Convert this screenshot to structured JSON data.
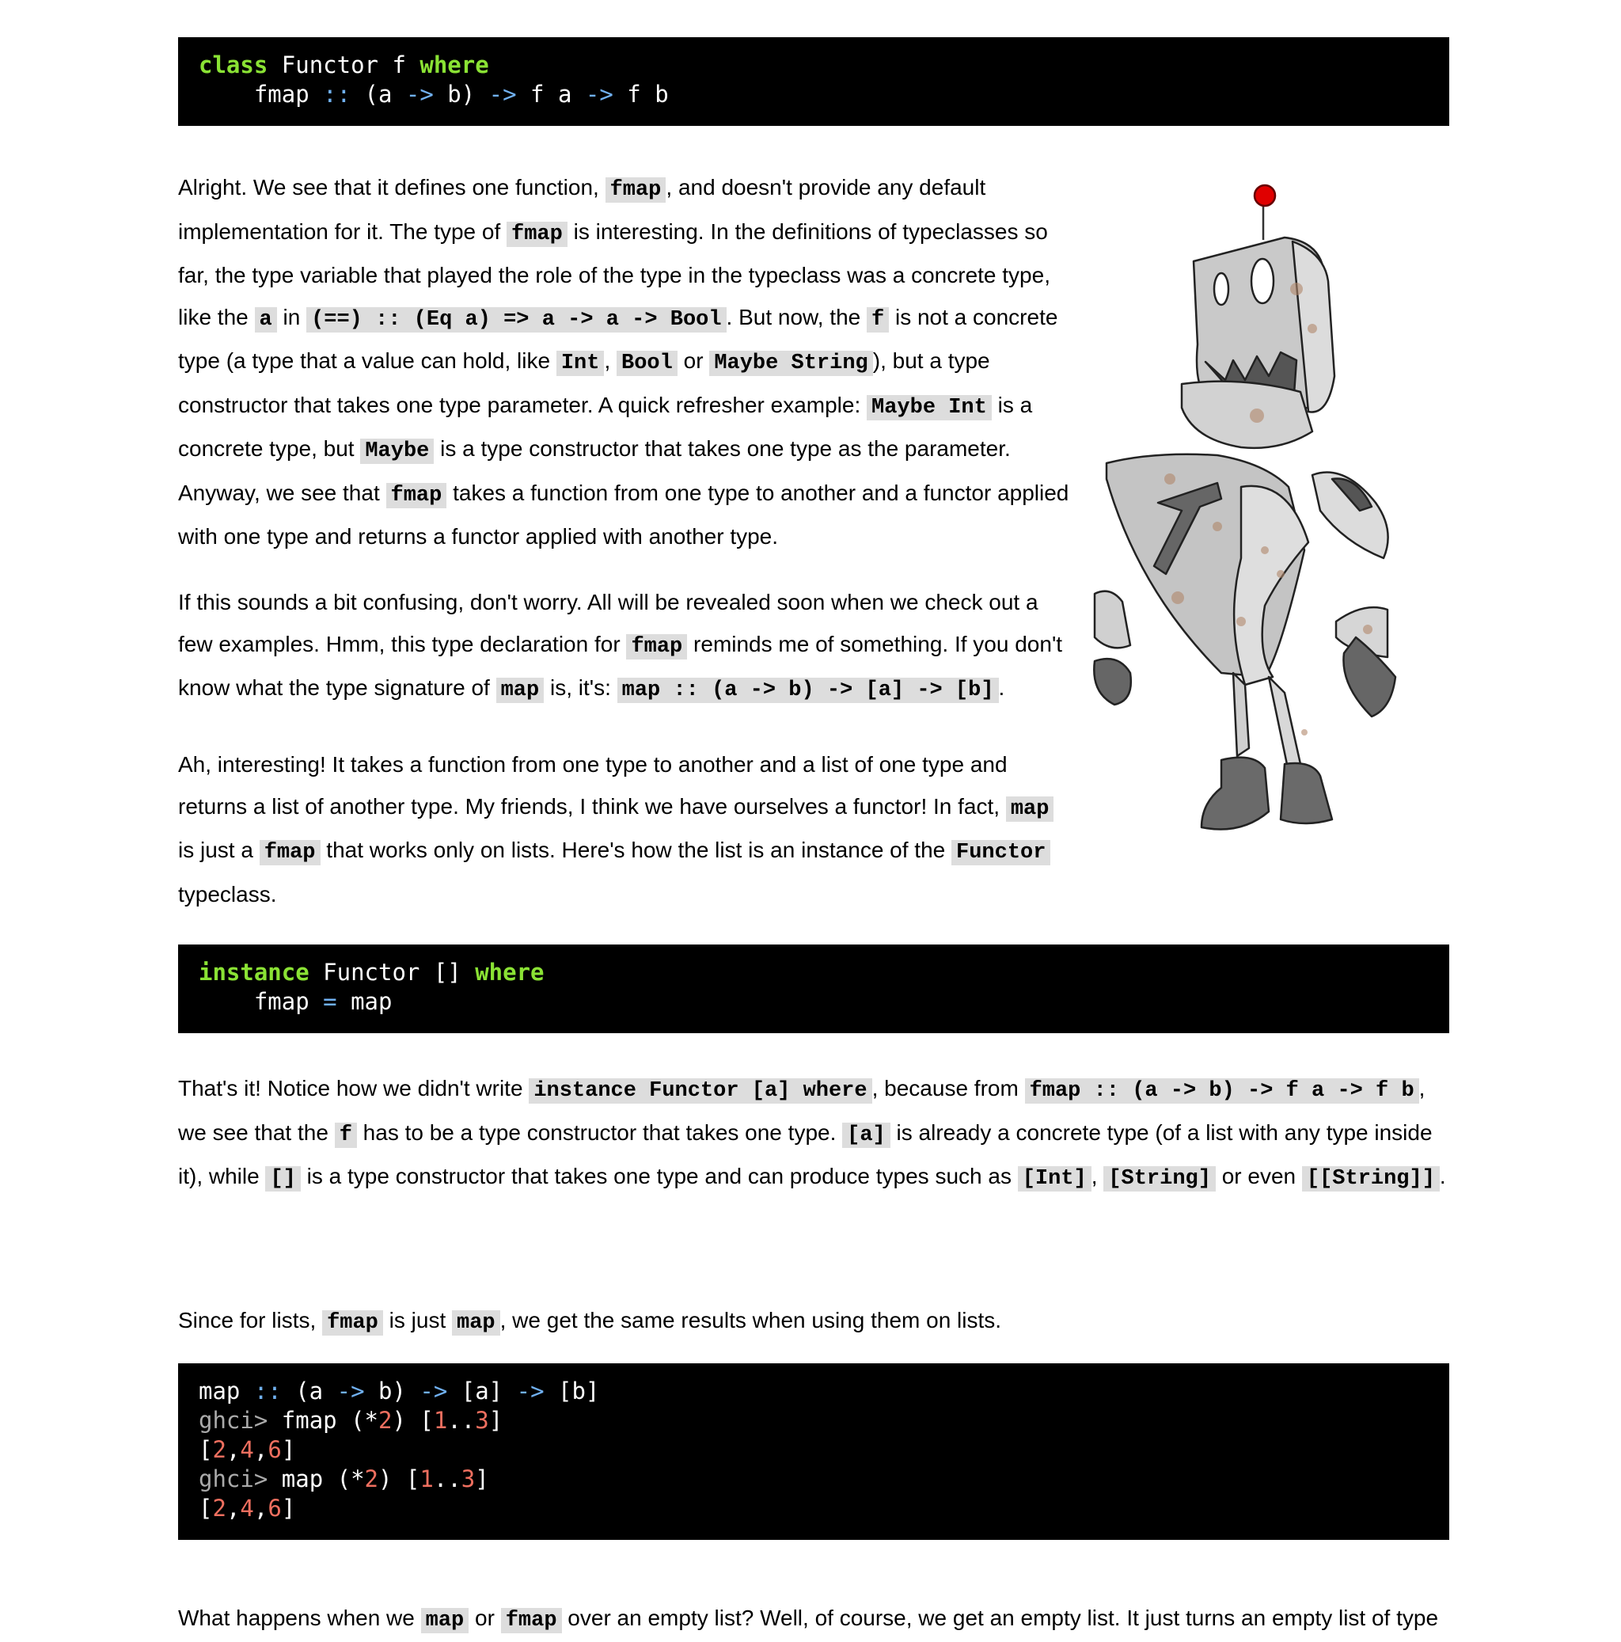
{
  "code1": {
    "l1": {
      "kw1": "class",
      "t1": " Functor f ",
      "kw2": "where"
    },
    "l2": {
      "t1": "    fmap ",
      "op1": "::",
      "t2": " (a ",
      "op2": "->",
      "t3": " b) ",
      "op3": "->",
      "t4": " f a ",
      "op4": "->",
      "t5": " f b"
    }
  },
  "para1": {
    "s1": "Alright. We see that it defines one function, ",
    "c1": "fmap",
    "s2": ", and doesn't provide any default implementation for it. The type of ",
    "c2": "fmap",
    "s3": " is interesting. In the definitions of typeclasses so far, the type variable that played the role of the type in the typeclass was a concrete type, like the ",
    "c3": "a",
    "s4": " in ",
    "c4": "(==) :: (Eq a) => a -> a -> Bool",
    "s5": ". But now, the ",
    "c5": "f",
    "s6": " is not a concrete type (a type that a value can hold, like ",
    "c6": "Int",
    "s7": ", ",
    "c7": "Bool",
    "s8": " or ",
    "c8": "Maybe String",
    "s9": "), but a type constructor that takes one type parameter. A quick refresher example: ",
    "c9": "Maybe Int",
    "s10": " is a concrete type, but ",
    "c10": "Maybe",
    "s11": " is a type constructor that takes one type as the parameter. Anyway, we see that ",
    "c11": "fmap",
    "s12": " takes a function from one type to another and a functor applied with one type and returns a functor applied with another type."
  },
  "para2": {
    "s1": "If this sounds a bit confusing, don't worry. All will be revealed soon when we check out a few examples. Hmm, this type declaration for ",
    "c1": "fmap",
    "s2": " reminds me of something. If you don't know what the type signature of ",
    "c2": "map",
    "s3": " is, it's: ",
    "c3": "map :: (a -> b) -> [a] -> [b]",
    "s4": "."
  },
  "para3": {
    "s1": "Ah, interesting! It takes a function from one type to another and a list of one type and returns a list of another type. My friends, I think we have ourselves a functor! In fact, ",
    "c1": "map",
    "s2": " is just a ",
    "c2": "fmap",
    "s3": " that works only on lists. Here's how the list is an instance of the ",
    "c3": "Functor",
    "s4": " typeclass."
  },
  "code2": {
    "l1": {
      "kw1": "instance",
      "t1": " Functor [] ",
      "kw2": "where"
    },
    "l2": {
      "t1": "    fmap ",
      "op1": "=",
      "t2": " map"
    }
  },
  "para4": {
    "s1": "That's it! Notice how we didn't write ",
    "c1": "instance Functor [a] where",
    "s2": ", because from ",
    "c2": "fmap :: (a -> b) -> f a -> f b",
    "s3": ", we see that the ",
    "c3": "f",
    "s4": " has to be a type constructor that takes one type. ",
    "c4": "[a]",
    "s5": " is already a concrete type (of a list with any type inside it), while ",
    "c5": "[]",
    "s6": " is a type constructor that takes one type and can produce types such as ",
    "c6": "[Int]",
    "s7": ", ",
    "c7": "[String]",
    "s8": " or even ",
    "c8": "[[String]]",
    "s9": "."
  },
  "para5": {
    "s1": "Since for lists, ",
    "c1": "fmap",
    "s2": " is just ",
    "c2": "map",
    "s3": ", we get the same results when using them on lists."
  },
  "code3": {
    "l1": {
      "t1": "map ",
      "op1": "::",
      "t2": " (a ",
      "op2": "->",
      "t3": " b) ",
      "op3": "->",
      "t4": " [a] ",
      "op4": "->",
      "t5": " [b]"
    },
    "l2": {
      "prompt": "ghci>",
      "t1": " fmap (*",
      "n1": "2",
      "t2": ") [",
      "n2": "1",
      "t3": "..",
      "n3": "3",
      "t4": "]"
    },
    "l3": {
      "t1": "[",
      "n1": "2",
      "t2": ",",
      "n2": "4",
      "t3": ",",
      "n3": "6",
      "t4": "]"
    },
    "l4": {
      "prompt": "ghci>",
      "t1": " map (*",
      "n1": "2",
      "t2": ") [",
      "n2": "1",
      "t3": "..",
      "n3": "3",
      "t4": "]"
    },
    "l5": {
      "t1": "[",
      "n1": "2",
      "t2": ",",
      "n2": "4",
      "t3": ",",
      "n3": "6",
      "t4": "]"
    }
  },
  "para6": {
    "s1": "What happens when we ",
    "c1": "map",
    "s2": " or ",
    "c2": "fmap",
    "s3": " over an empty list? Well, of course, we get an empty list. It just turns an empty list of type"
  },
  "illustration": {
    "icon": "robot-illustration",
    "antenna_color": "#e00000",
    "body_color": "#c8c8c8"
  }
}
